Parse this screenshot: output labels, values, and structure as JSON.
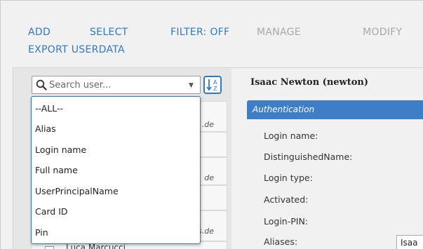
{
  "toolbar": {
    "add": "ADD",
    "select": "SELECT",
    "filter": "FILTER: OFF",
    "manage": "MANAGE",
    "modify": "MODIFY",
    "export": "EXPORT USERDATA"
  },
  "search": {
    "placeholder": "Search user...",
    "options": [
      "--ALL--",
      "Alias",
      "Login name",
      "Full name",
      "UserPrincipalName",
      "Card ID",
      "Pin"
    ]
  },
  "user_list": {
    "domain_fragments": [
      ".de",
      "de",
      "s.de"
    ],
    "partial_name": "Luca.Marcucci"
  },
  "detail": {
    "title": "Isaac Newton (newton)",
    "section": "Authentication",
    "fields": [
      "Login name:",
      "DistinguishedName:",
      "Login type:",
      "Activated:",
      "Login-PIN:",
      "Aliases:"
    ],
    "alias_value": "Isaa"
  }
}
